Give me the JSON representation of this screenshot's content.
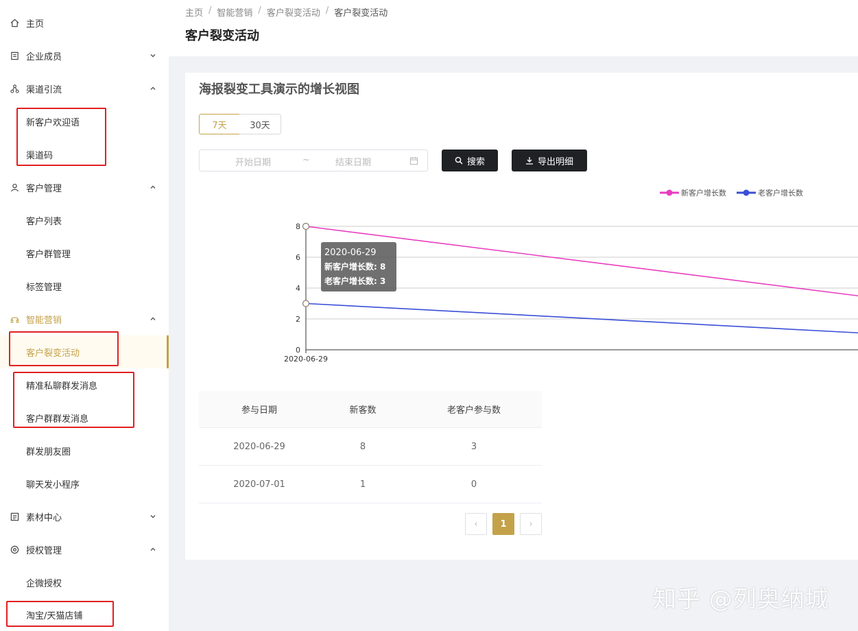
{
  "sidebar": {
    "items": [
      {
        "label": "主页",
        "icon": "home-icon"
      },
      {
        "label": "企业成员",
        "icon": "id-card-icon"
      },
      {
        "label": "渠道引流",
        "icon": "network-icon"
      },
      {
        "label": "新客户欢迎语"
      },
      {
        "label": "渠道码"
      },
      {
        "label": "客户管理",
        "icon": "user-icon"
      },
      {
        "label": "客户列表"
      },
      {
        "label": "客户群管理"
      },
      {
        "label": "标签管理"
      },
      {
        "label": "智能营销",
        "icon": "headset-icon"
      },
      {
        "label": "客户裂变活动"
      },
      {
        "label": "精准私聊群发消息"
      },
      {
        "label": "客户群群发消息"
      },
      {
        "label": "群发朋友圈"
      },
      {
        "label": "聊天发小程序"
      },
      {
        "label": "素材中心",
        "icon": "document-icon"
      },
      {
        "label": "授权管理",
        "icon": "target-icon"
      },
      {
        "label": "企微授权"
      },
      {
        "label": "淘宝/天猫店铺"
      }
    ]
  },
  "breadcrumb": [
    "主页",
    "智能营销",
    "客户裂变活动",
    "客户裂变活动"
  ],
  "page_title": "客户裂变活动",
  "card": {
    "title": "海报裂变工具演示的增长视图",
    "range_tabs": [
      "7天",
      "30天"
    ],
    "date_start_placeholder": "开始日期",
    "date_sep": "~",
    "date_end_placeholder": "结束日期",
    "search_label": "搜索",
    "export_label": "导出明细"
  },
  "chart_data": {
    "type": "line",
    "x": [
      "2020-06-29"
    ],
    "series": [
      {
        "name": "新客户增长数",
        "color": "#e83ec0",
        "values": [
          8,
          3.5
        ]
      },
      {
        "name": "老客户增长数",
        "color": "#3a4fd8",
        "values": [
          3,
          1.1
        ]
      }
    ],
    "y_ticks": [
      0,
      2,
      4,
      6,
      8
    ],
    "ylim": [
      0,
      8
    ],
    "grid": true,
    "legend_position": "top-right",
    "tooltip": {
      "date": "2020-06-29",
      "lines": [
        "新客户增长数: 8",
        "老客户增长数: 3"
      ]
    }
  },
  "table": {
    "headers": [
      "参与日期",
      "新客数",
      "老客户参与数"
    ],
    "rows": [
      [
        "2020-06-29",
        "8",
        "3"
      ],
      [
        "2020-07-01",
        "1",
        "0"
      ]
    ]
  },
  "pagination": {
    "prev": "‹",
    "page": "1",
    "next": "›"
  },
  "watermark": "知乎 @列奥纳城",
  "colors": {
    "accent": "#c4a24a",
    "annotation": "#e02020",
    "dark_button": "#1f2125"
  }
}
